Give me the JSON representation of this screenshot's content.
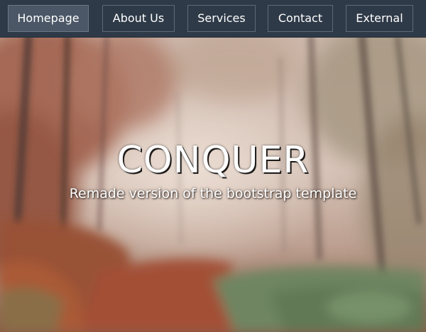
{
  "nav": {
    "items": [
      {
        "label": "Homepage",
        "active": true
      },
      {
        "label": "About Us",
        "active": false
      },
      {
        "label": "Services",
        "active": false
      },
      {
        "label": "Contact",
        "active": false
      },
      {
        "label": "External",
        "active": false
      }
    ]
  },
  "hero": {
    "title": "CONQUER",
    "subtitle": "Remade version of the bootstrap template",
    "background": "blurred-autumn-forest-path"
  },
  "colors": {
    "navbar": "#2f3a48",
    "nav_active": "#4b5766",
    "nav_border": "#5f6976",
    "text": "#ffffff"
  }
}
